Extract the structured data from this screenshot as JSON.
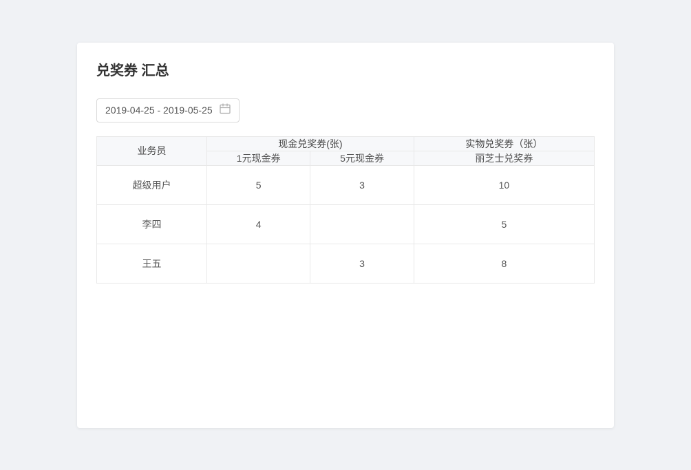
{
  "title": "兑奖券 汇总",
  "datepicker": {
    "value": "2019-04-25 - 2019-05-25",
    "icon": "📅"
  },
  "table": {
    "col_salesperson": "业务员",
    "col_cash_group": "现金兑奖券(张)",
    "col_physical_group": "实物兑奖券（张）",
    "col_cash_1": "1元现金券",
    "col_cash_5": "5元现金券",
    "col_physical_1": "丽芝士兑奖券",
    "rows": [
      {
        "name": "超级用户",
        "cash_1": "5",
        "cash_5": "3",
        "physical_1": "10"
      },
      {
        "name": "李四",
        "cash_1": "4",
        "cash_5": "",
        "physical_1": "5"
      },
      {
        "name": "王五",
        "cash_1": "",
        "cash_5": "3",
        "physical_1": "8"
      }
    ]
  }
}
